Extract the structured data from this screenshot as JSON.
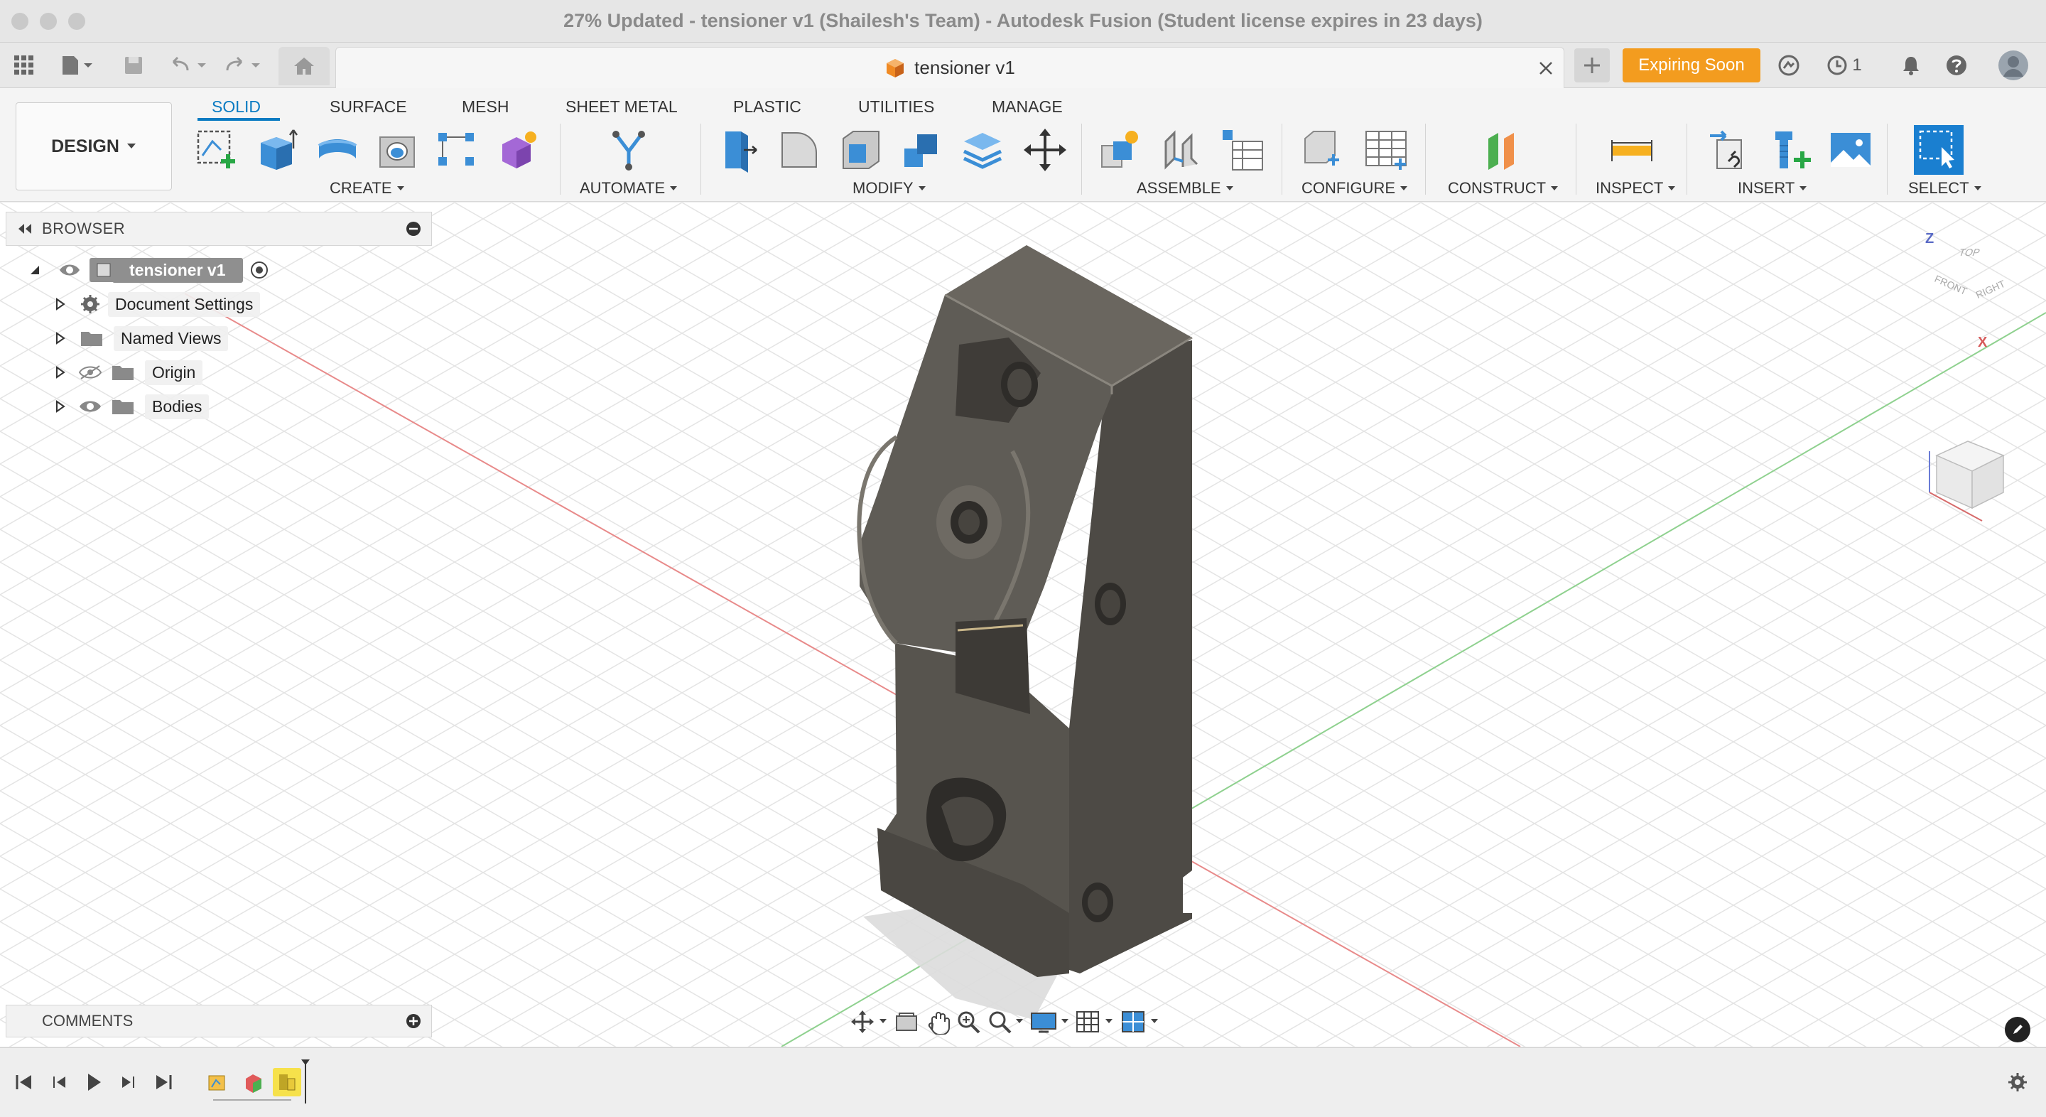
{
  "window": {
    "title": "27% Updated - tensioner v1 (Shailesh's Team) - Autodesk Fusion (Student license expires in 23 days)"
  },
  "appbar": {
    "document_tab": "tensioner v1",
    "expiring_label": "Expiring Soon",
    "job_count": "1"
  },
  "ribbon": {
    "workspace": "DESIGN",
    "tabs": [
      "SOLID",
      "SURFACE",
      "MESH",
      "SHEET METAL",
      "PLASTIC",
      "UTILITIES",
      "MANAGE"
    ],
    "active_tab": "SOLID",
    "groups": [
      "CREATE",
      "AUTOMATE",
      "MODIFY",
      "ASSEMBLE",
      "CONFIGURE",
      "CONSTRUCT",
      "INSPECT",
      "INSERT",
      "SELECT"
    ]
  },
  "browser": {
    "title": "BROWSER",
    "root": "tensioner v1",
    "items": [
      "Document Settings",
      "Named Views",
      "Origin",
      "Bodies"
    ]
  },
  "viewcube": {
    "top": "TOP",
    "front": "FRONT",
    "right": "RIGHT",
    "axis_z": "Z",
    "axis_x": "X"
  },
  "comments": {
    "title": "COMMENTS"
  },
  "colors": {
    "accent": "#0a7bc2",
    "expiring": "#f39c1f",
    "model": "#5f5c56",
    "axis_red": "#e88a8a",
    "axis_green": "#8fd18f"
  }
}
